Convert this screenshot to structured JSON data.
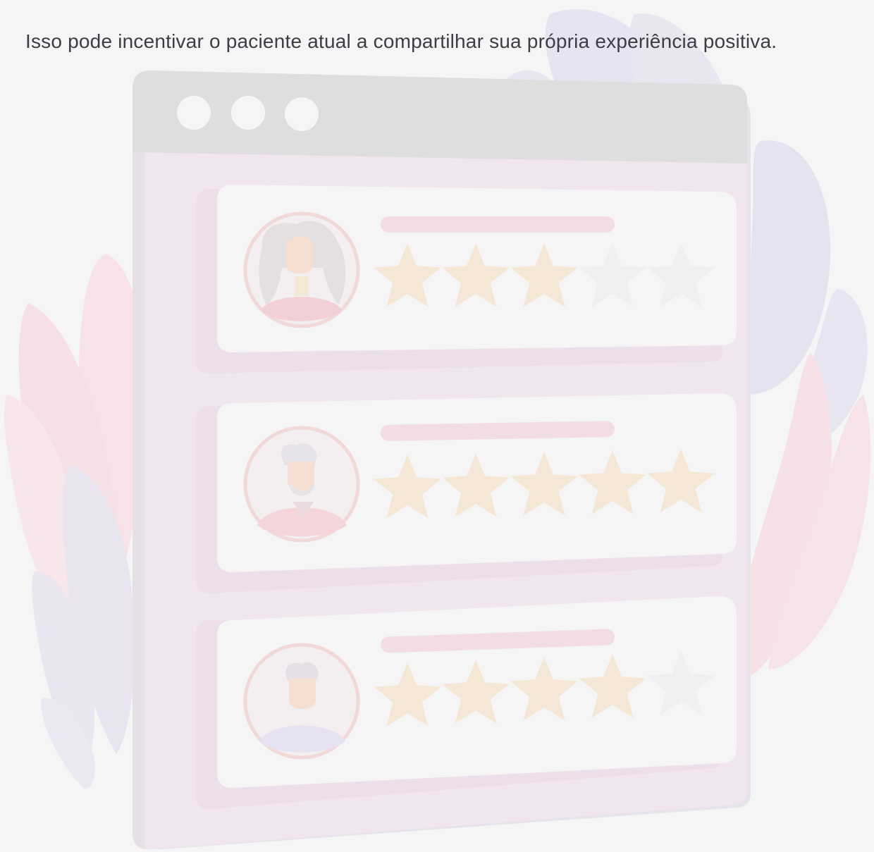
{
  "intro": {
    "text": "Isso pode incentivar o paciente atual a compartilhar sua própria experiência positiva."
  },
  "illustration": {
    "window_dots": 3,
    "reviews": [
      {
        "avatar": "woman-avatar-icon",
        "rating": 3,
        "max": 5
      },
      {
        "avatar": "bearded-man-avatar-icon",
        "rating": 5,
        "max": 5
      },
      {
        "avatar": "young-man-avatar-icon",
        "rating": 4,
        "max": 5
      }
    ],
    "colors": {
      "background": "#f5f5f5",
      "window_header": "#dededf",
      "window_body": "#f1e5ee",
      "card": "#f5f5f5",
      "star_filled": "#f5e7d6",
      "star_empty": "#efeff0",
      "name_bar": "#f2dde2",
      "leaf_pink": "#f5e1e6",
      "leaf_lavender": "#e7e4f1"
    }
  }
}
